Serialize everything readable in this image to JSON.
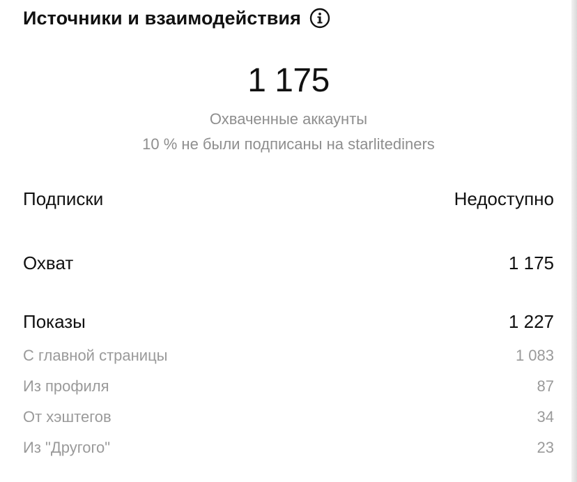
{
  "header": {
    "title": "Источники и взаимодействия",
    "info_icon": "info-circle-icon"
  },
  "summary": {
    "value": "1 175",
    "label": "Охваченные аккаунты",
    "note": "10 % не были подписаны на starlitediners"
  },
  "metrics": {
    "follows": {
      "label": "Подписки",
      "value": "Недоступно"
    },
    "reach": {
      "label": "Охват",
      "value": "1 175"
    },
    "impressions": {
      "label": "Показы",
      "value": "1 227",
      "breakdown": [
        {
          "label": "С главной страницы",
          "value": "1 083"
        },
        {
          "label": "Из профиля",
          "value": "87"
        },
        {
          "label": "От хэштегов",
          "value": "34"
        },
        {
          "label": "Из \"Другого\"",
          "value": "23"
        }
      ]
    }
  }
}
